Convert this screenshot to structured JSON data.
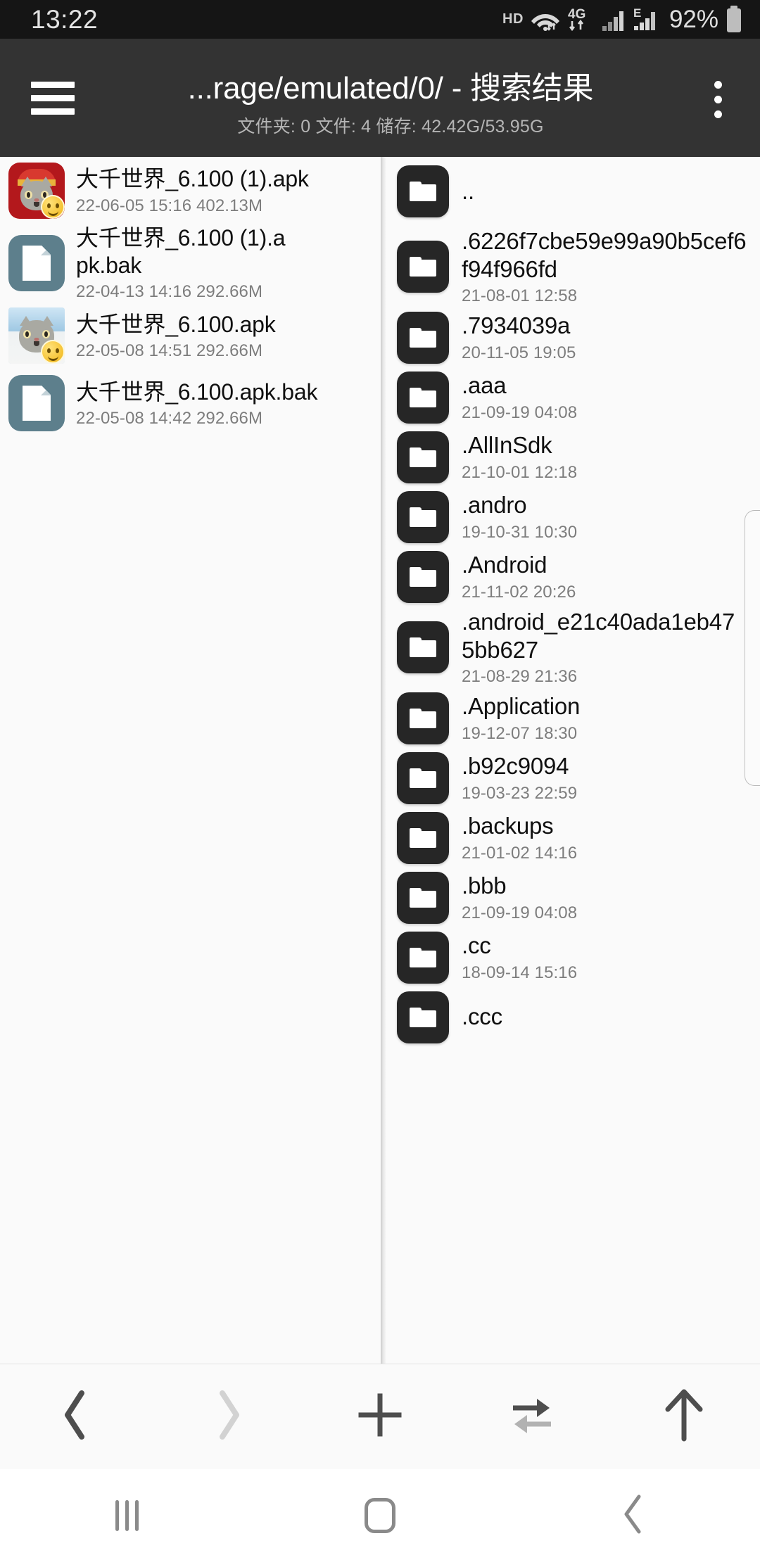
{
  "status_bar": {
    "time": "13:22",
    "hd_label": "HD",
    "battery_percent": "92%",
    "network_label": "4G",
    "network_label_2": "E",
    "icons": [
      "wifi-icon",
      "mobile-data-4g-icon",
      "signal-bars-icon",
      "edge-signal-icon",
      "battery-icon"
    ]
  },
  "app_bar": {
    "menu_icon": "hamburger-menu-icon",
    "title": "...rage/emulated/0/ - 搜索结果",
    "subtitle": "文件夹: 0  文件: 4  储存: 42.42G/53.95G",
    "overflow_icon": "kebab-menu-icon"
  },
  "left_pane": {
    "items": [
      {
        "name": "大千世界_6.100 (1).apk",
        "info": "22-06-05 15:16  402.13M",
        "icon": "apk-cat-red-icon",
        "type": "apk"
      },
      {
        "name": "大千世界_6.100 (1).apk.bak",
        "info": "22-04-13 14:16  292.66M",
        "icon": "document-icon",
        "type": "doc"
      },
      {
        "name": "大千世界_6.100.apk",
        "info": "22-05-08 14:51  292.66M",
        "icon": "apk-cat-sky-icon",
        "type": "apk2"
      },
      {
        "name": "大千世界_6.100.apk.bak",
        "info": "22-05-08 14:42  292.66M",
        "icon": "document-icon",
        "type": "doc"
      }
    ]
  },
  "right_pane": {
    "items": [
      {
        "name": "..",
        "info": "",
        "icon": "folder-icon"
      },
      {
        "name": ".6226f7cbe59e99a90b5cef6f94f966fd",
        "info": "21-08-01 12:58",
        "icon": "folder-icon"
      },
      {
        "name": ".7934039a",
        "info": "20-11-05 19:05",
        "icon": "folder-icon"
      },
      {
        "name": ".aaa",
        "info": "21-09-19 04:08",
        "icon": "folder-icon"
      },
      {
        "name": ".AllInSdk",
        "info": "21-10-01 12:18",
        "icon": "folder-icon"
      },
      {
        "name": ".andro",
        "info": "19-10-31 10:30",
        "icon": "folder-icon"
      },
      {
        "name": ".Android",
        "info": "21-11-02 20:26",
        "icon": "folder-icon"
      },
      {
        "name": ".android_e21c40ada1eb475bb627",
        "info": "21-08-29 21:36",
        "icon": "folder-icon"
      },
      {
        "name": ".Application",
        "info": "19-12-07 18:30",
        "icon": "folder-icon"
      },
      {
        "name": ".b92c9094",
        "info": "19-03-23 22:59",
        "icon": "folder-icon"
      },
      {
        "name": ".backups",
        "info": "21-01-02 14:16",
        "icon": "folder-icon"
      },
      {
        "name": ".bbb",
        "info": "21-09-19 04:08",
        "icon": "folder-icon"
      },
      {
        "name": ".cc",
        "info": "18-09-14 15:16",
        "icon": "folder-icon"
      },
      {
        "name": ".ccc",
        "info": "",
        "icon": "folder-icon"
      }
    ]
  },
  "toolbar": {
    "buttons": [
      {
        "name": "back-button",
        "icon": "chevron-left-icon",
        "enabled": true
      },
      {
        "name": "forward-button",
        "icon": "chevron-right-icon",
        "enabled": false
      },
      {
        "name": "add-button",
        "icon": "plus-icon",
        "enabled": true
      },
      {
        "name": "transfer-button",
        "icon": "swap-arrows-icon",
        "enabled": true
      },
      {
        "name": "up-button",
        "icon": "arrow-up-icon",
        "enabled": true
      }
    ]
  },
  "nav_bar": {
    "buttons": [
      {
        "name": "recents-button",
        "icon": "recents-icon"
      },
      {
        "name": "home-button",
        "icon": "home-icon"
      },
      {
        "name": "back-button",
        "icon": "back-chevron-icon"
      }
    ]
  },
  "colors": {
    "status_bar_bg": "#151515",
    "app_bar_bg": "#333333",
    "pane_bg": "#fafafa",
    "folder_icon_bg": "#262626",
    "doc_icon_bg": "#5d7f8c",
    "text_primary": "#101010",
    "text_secondary": "#7d7d7d"
  }
}
